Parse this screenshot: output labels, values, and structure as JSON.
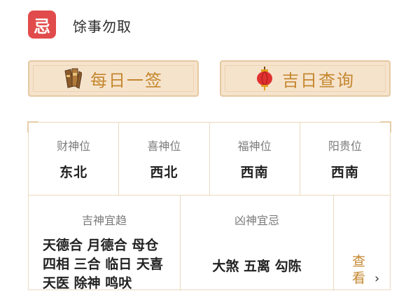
{
  "header": {
    "icon_char": "忌",
    "title": "馀事勿取"
  },
  "actions": {
    "left": {
      "label": "每日一签",
      "icon": "fortune-sticks-icon"
    },
    "right": {
      "label": "吉日查询",
      "icon": "lantern-icon"
    }
  },
  "positions": [
    {
      "label": "财神位",
      "value": "东北"
    },
    {
      "label": "喜神位",
      "value": "西北"
    },
    {
      "label": "福神位",
      "value": "西南"
    },
    {
      "label": "阳贵位",
      "value": "西南"
    }
  ],
  "deities": {
    "good": {
      "title": "吉神宜趋",
      "lines": [
        "天德合 月德合 母仓",
        "四相 三合 临日 天喜",
        "天医 除神 鸣吠"
      ]
    },
    "bad": {
      "title": "凶神宜忌",
      "text": "大煞 五离 勾陈"
    },
    "more": {
      "label": "查看",
      "arrow": "›"
    }
  },
  "colors": {
    "brand_red": "#e24b4b",
    "gold_text": "#c4872e",
    "button_bg": "#f6e3cc",
    "border": "#ecd9be"
  }
}
